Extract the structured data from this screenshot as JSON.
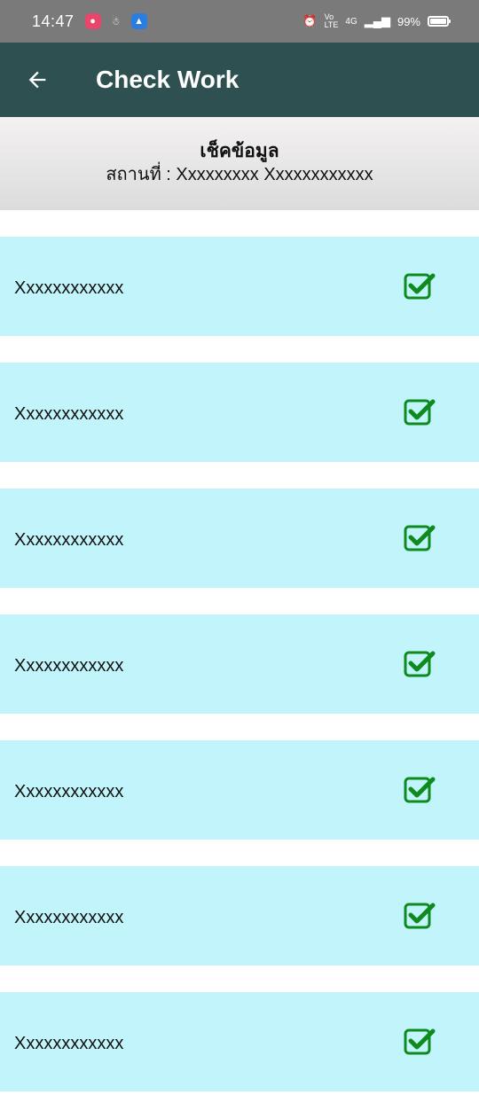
{
  "status_bar": {
    "time": "14:47",
    "network": "4G",
    "battery_percent_text": "99%",
    "battery_level": 0.99
  },
  "app_bar": {
    "title": "Check Work",
    "back_icon": "arrow-left-icon",
    "background": "#2f5050"
  },
  "header": {
    "title": "เช็คข้อมูล",
    "location": "สถานที่ : Xxxxxxxxx Xxxxxxxxxxxx"
  },
  "items": [
    {
      "label": "Xxxxxxxxxxxx",
      "checked": true
    },
    {
      "label": "Xxxxxxxxxxxx",
      "checked": true
    },
    {
      "label": "Xxxxxxxxxxxx",
      "checked": true
    },
    {
      "label": "Xxxxxxxxxxxx",
      "checked": true
    },
    {
      "label": "Xxxxxxxxxxxx",
      "checked": true
    },
    {
      "label": "Xxxxxxxxxxxx",
      "checked": true
    },
    {
      "label": "Xxxxxxxxxxxx",
      "checked": true
    }
  ],
  "colors": {
    "list_item_bg": "#c1f5fb",
    "check_green": "#0f8a1e"
  }
}
